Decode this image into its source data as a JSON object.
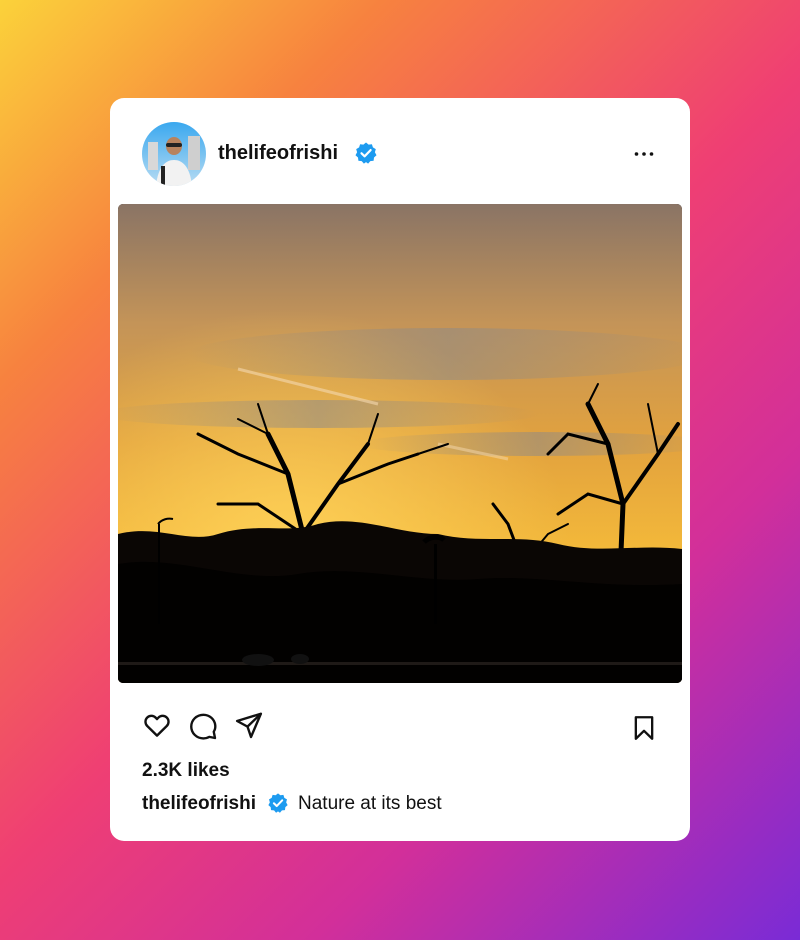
{
  "post": {
    "username": "thelifeofrishi",
    "likes": "2.3K likes",
    "caption_user": "thelifeofrishi",
    "caption_text": "Nature at its best"
  },
  "icons": {
    "verified": "verified-badge-icon",
    "more": "more-options-icon",
    "like": "heart-icon",
    "comment": "comment-icon",
    "share": "send-icon",
    "save": "bookmark-icon"
  },
  "colors": {
    "verified_blue": "#1d9bf0",
    "text": "#111111"
  }
}
